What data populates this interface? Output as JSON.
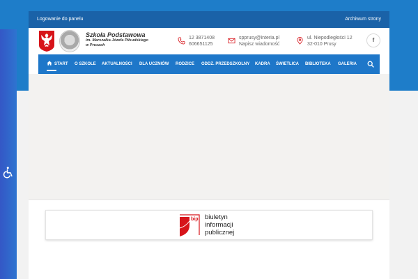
{
  "topbar": {
    "login_label": "Logowanie do panelu",
    "archive_label": "Archiwum strony"
  },
  "school": {
    "name_line1": "Szkoła Podstawowa",
    "name_line2": "im. Marszałka Józefa Piłsudskiego",
    "name_line3": "w Prusach"
  },
  "contact": {
    "phone1": "12 3871408",
    "phone2": "606651125",
    "email": "spprusy@interia.pl",
    "email_sub": "Napisz wiadomość",
    "address1": "ul. Niepodległości 12",
    "address2": "32-010 Prusy"
  },
  "social": {
    "facebook_label": "f"
  },
  "nav": {
    "items": [
      {
        "label": "START",
        "icon": "home-icon",
        "active": true
      },
      {
        "label": "O SZKOLE"
      },
      {
        "label": "AKTUALNOŚCI"
      },
      {
        "label": "DLA UCZNIÓW"
      },
      {
        "label": "RODZICE"
      },
      {
        "label": "ODDZ. PRZEDSZKOLNY"
      },
      {
        "label": "KADRA"
      },
      {
        "label": "ŚWIETLICA"
      },
      {
        "label": "BIBLIOTEKA"
      },
      {
        "label": "GALERIA"
      }
    ],
    "search_icon": "search-icon"
  },
  "bip": {
    "logo_text": "bip",
    "line1": "biuletyn",
    "line2": "informacji",
    "line3": "publicznej"
  },
  "accessibility": {
    "icon": "wheelchair-icon"
  },
  "colors": {
    "accent": "#1e77c9",
    "topbar": "#1a62a8",
    "side_strip": "#3457c6",
    "bip_red": "#d7141a"
  }
}
